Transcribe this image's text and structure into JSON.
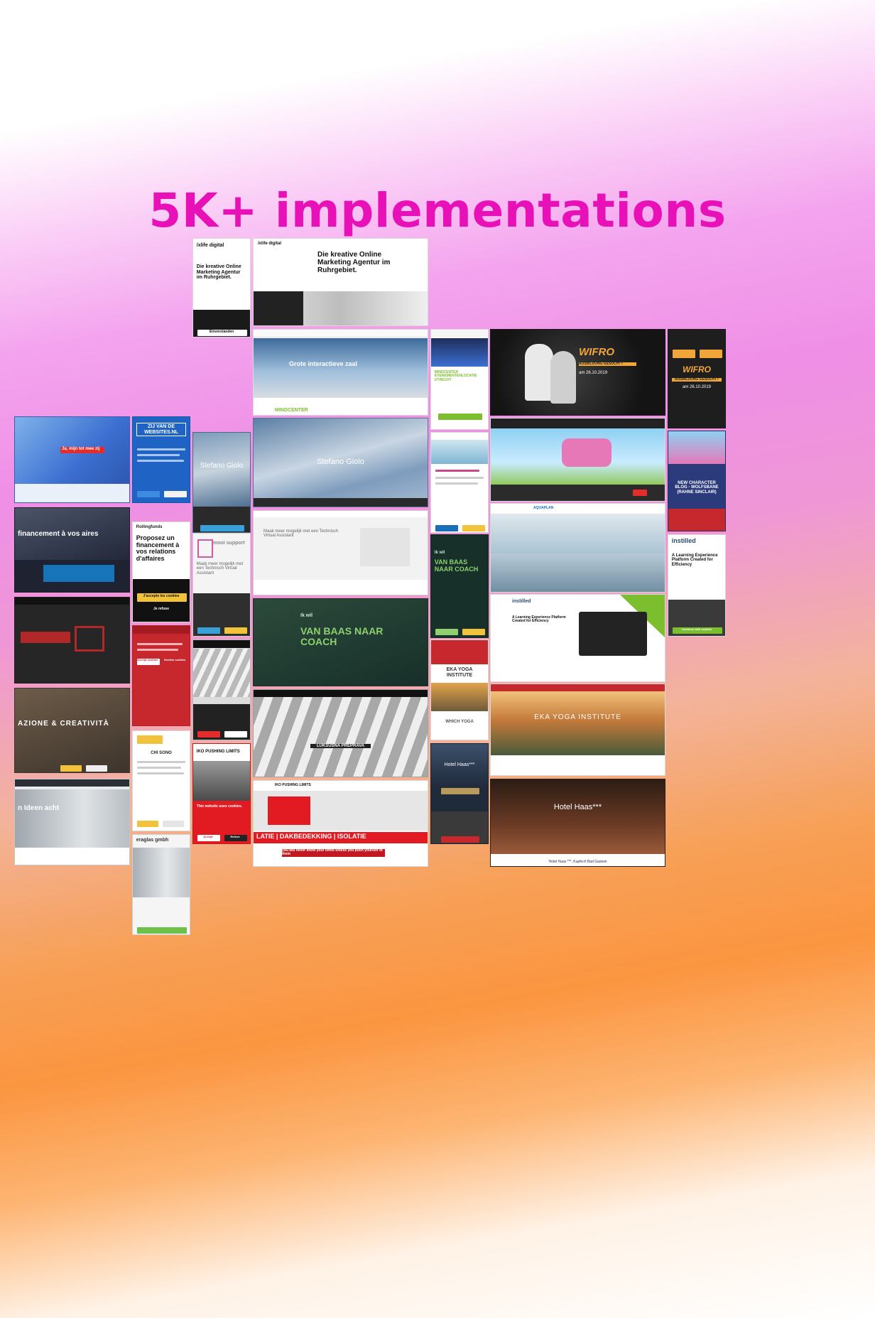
{
  "headline": "5K+ implementations",
  "colors": {
    "headline": "#e811b7",
    "gradient_top": "#ffffff",
    "gradient_pink": "#ef8fe6",
    "gradient_orange": "#fb9540"
  },
  "tiles": {
    "xlife_mobile": {
      "logo": "/xlife digital",
      "heading": "Die kreative Online Marketing Agentur im Ruhrgebiet.",
      "button": "Einverstanden"
    },
    "xlife_desktop": {
      "logo": "/xlife digital",
      "heading": "Die kreative Online Marketing Agentur im Ruhrgebiet."
    },
    "mindcenter": {
      "heading": "Grote interactieve zaal",
      "footer": "MINDCENTER"
    },
    "mindcenter_mobile": {
      "heading": "MINDCENTER EVENEMENTENLOCATIE UTRECHT"
    },
    "wifro": {
      "brand": "WIFRO",
      "subtitle": "AUSBILDUNG GESUCHT?",
      "date": "am 26.10.2019"
    },
    "wifro_mobile": {
      "brand": "WIFRO",
      "subtitle": "AUSBILDUNG GESUCHT?",
      "date": "am 26.10.2019"
    },
    "stefano_mobile": {
      "name": "Stefano Giolo"
    },
    "stefano_desktop": {
      "name": "Stefano Giolo"
    },
    "websites_nl": {
      "logo": "ZIJ VAN DE WEBSITES.NL"
    },
    "game_site": {
      "heading": "NEW CHARACTER BLOG - WOLFSBANE (RAHNE SINCLAIR)"
    },
    "rolling_funds": {
      "logo": "Rollingfunds",
      "heading": "Proposez un financement à vos relations d'affaires",
      "accept": "J'accepte les cookies",
      "refuse": "Je refuse"
    },
    "financement": {
      "heading": "financement à vos aires"
    },
    "mooi_support": {
      "logo": "mooi support",
      "heading": "Maak meer mogelijk met een Technisch Virtual Assistant"
    },
    "ik_wil_mobile": {
      "prefix": "Ik wil",
      "heading": "VAN BAAS NAAR COACH"
    },
    "ik_wil_desktop": {
      "prefix": "Ik wil",
      "heading": "VAN BAAS NAAR COACH"
    },
    "instilled_mobile": {
      "logo": "instilled",
      "heading": "A Learning Experience Platform Created for Efficiency",
      "button": "Continue with cookies"
    },
    "instilled_desktop": {
      "logo": "instilled",
      "heading": "A Learning Experience Platform Created for Efficiency"
    },
    "creativita": {
      "heading": "AZIONE & CREATIVITÀ"
    },
    "futura": {
      "title": "CHI SONO"
    },
    "eka_yoga_mobile": {
      "heading": "EKA YOGA INSTITUTE",
      "tagline": "WHICH YOGA"
    },
    "eka_yoga_desktop": {
      "heading": "EKA YOGA INSTITUTE"
    },
    "luksusna": {
      "heading": "LUKSUSNA PREPRAVA"
    },
    "iko_mobile": {
      "brand": "IKO PUSHING LIMITS",
      "notice": "This website uses cookies.",
      "accept": "Accept",
      "refuse": "Refuse"
    },
    "iko_desktop": {
      "brand": "IKO PUSHING LIMITS",
      "banner": "LATIE | DAKBEDEKKING | ISOLATIE",
      "tagline": "you will never know your limits unless you push yourself to them"
    },
    "hotel_haas_mobile": {
      "heading": "Hotel Haas***"
    },
    "hotel_haas_desktop": {
      "heading": "Hotel Haas***",
      "caption": "Hotel Haas ***, Kupfech Bad Gastein"
    },
    "seagull": {
      "button": "Ja, mijn tot mee zij"
    },
    "ideen": {
      "heading": "n Ideen acht"
    },
    "eraglas": {
      "logo": "eraglas gmbh"
    },
    "aquaplan": {
      "logo": "AQUAPLAN"
    },
    "cookie_red": {
      "accept": "Accept cookies",
      "decline": "Decline cookies"
    }
  }
}
